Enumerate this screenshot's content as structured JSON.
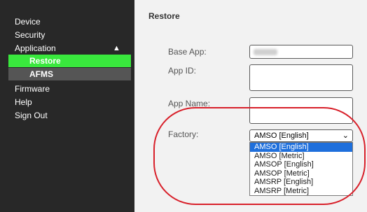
{
  "sidebar": {
    "items": [
      {
        "label": "Device"
      },
      {
        "label": "Security"
      },
      {
        "label": "Application",
        "arrow": "▲"
      },
      {
        "label": "Restore"
      },
      {
        "label": "AFMS"
      },
      {
        "label": "Firmware"
      },
      {
        "label": "Help"
      },
      {
        "label": "Sign Out"
      }
    ]
  },
  "main": {
    "title": "Restore",
    "fields": {
      "base_app_label": "Base App:",
      "app_id_label": "App ID:",
      "app_name_label": "App Name:",
      "factory_label": "Factory:"
    },
    "factory_select": {
      "value": "AMSO [English]",
      "chevron": "⌄",
      "options": [
        "AMSO [English]",
        "AMSO [Metric]",
        "AMSOP [English]",
        "AMSOP [Metric]",
        "AMSRP [English]",
        "AMSRP [Metric]"
      ]
    }
  },
  "colors": {
    "sidebar_bg": "#282828",
    "active_item": "#39e83d",
    "selected_option": "#1e6fdc",
    "highlight_ring": "#d8202a"
  }
}
